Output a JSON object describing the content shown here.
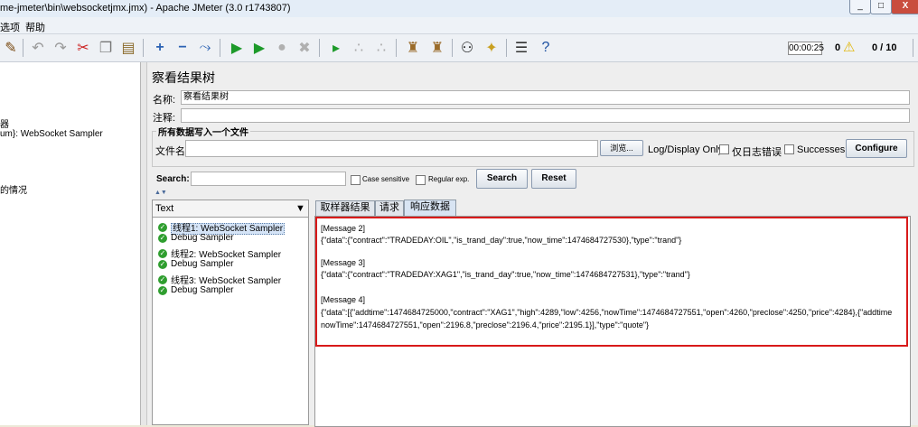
{
  "window": {
    "title": "me-jmeter\\bin\\websocketjmx.jmx) - Apache JMeter (3.0 r1743807)",
    "buttons": [
      "_",
      "□",
      "X"
    ]
  },
  "menu": {
    "items": [
      "选项",
      "帮助"
    ]
  },
  "toolbar": {
    "timer": "00:00:25",
    "warning_count": "0",
    "threads": "0 / 10"
  },
  "left_tree": {
    "items": [
      "器",
      "um}: WebSocket Sampler",
      "的情况"
    ]
  },
  "panel": {
    "title": "察看结果树",
    "name_label": "名称:",
    "name_value": "察看结果树",
    "comment_label": "注释:",
    "file_group_label": "所有数据写入一个文件",
    "file_label": "文件名",
    "browse_label": "浏览...",
    "logdisplay_label": "Log/Display Only:",
    "errors_only_label": "仅日志错误",
    "successes_label": "Successes",
    "configure_label": "Configure"
  },
  "search": {
    "label": "Search:",
    "case_sensitive_label": "Case sensitive",
    "regex_label": "Regular exp.",
    "search_button": "Search",
    "reset_button": "Reset"
  },
  "results": {
    "renderer": "Text",
    "items": [
      {
        "label": "线程1:  WebSocket Sampler",
        "selected": true
      },
      {
        "label": "Debug Sampler",
        "selected": false
      },
      {
        "label": "线程2:  WebSocket Sampler",
        "selected": false
      },
      {
        "label": "Debug Sampler",
        "selected": false
      },
      {
        "label": "线程3:  WebSocket Sampler",
        "selected": false
      },
      {
        "label": "Debug Sampler",
        "selected": false
      }
    ]
  },
  "tabs": {
    "sampler_result": "取样器结果",
    "request": "请求",
    "response": "响应数据"
  },
  "response": {
    "lines": [
      "[Message 2]",
      "{\"data\":{\"contract\":\"TRADEDAY:OIL\",\"is_trand_day\":true,\"now_time\":1474684727530},\"type\":\"trand\"}",
      "",
      "[Message 3]",
      "{\"data\":{\"contract\":\"TRADEDAY:XAG1\",\"is_trand_day\":true,\"now_time\":1474684727531},\"type\":\"trand\"}",
      "",
      "[Message 4]",
      "{\"data\":[{\"addtime\":1474684725000,\"contract\":\"XAG1\",\"high\":4289,\"low\":4256,\"nowTime\":1474684727551,\"open\":4260,\"preclose\":4250,\"price\":4284},{\"addtime",
      "nowTime\":1474684727551,\"open\":2196.8,\"preclose\":2196.4,\"price\":2195.1}],\"type\":\"quote\"}"
    ]
  },
  "colors": {
    "highlight_border": "#d81a1a",
    "success_icon": "#2f9e2f"
  }
}
